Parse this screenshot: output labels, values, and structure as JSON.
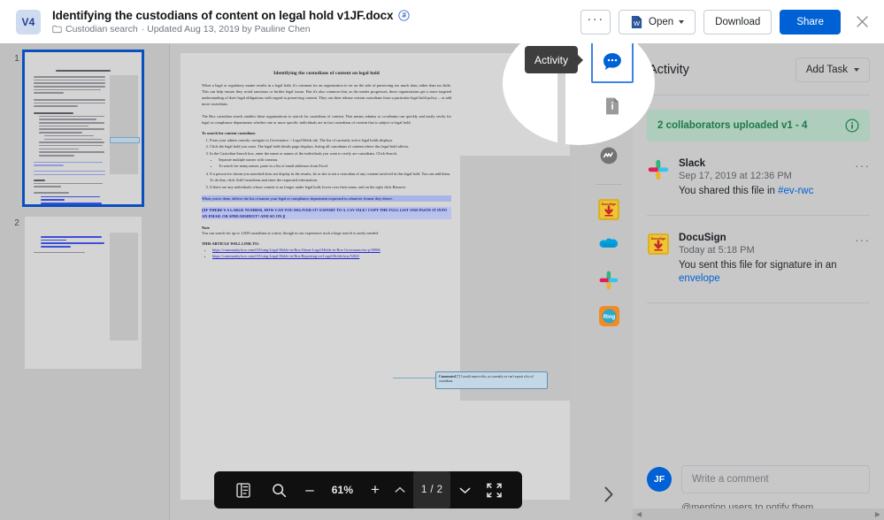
{
  "header": {
    "version_badge": "V4",
    "title": "Identifying the custodians of content on legal hold v1JF.docx",
    "folder_name": "Custodian search",
    "meta": "· Updated Aug 13, 2019 by Pauline Chen",
    "more_label": "···",
    "open_label": "Open",
    "download_label": "Download",
    "share_label": "Share",
    "accent_color": "#0061d5"
  },
  "thumbnails": {
    "pages": [
      {
        "number": "1",
        "selected": true
      },
      {
        "number": "2",
        "selected": false
      }
    ]
  },
  "document": {
    "heading": "Identifying the custodians of content on legal hold",
    "p1": "When a legal or regulatory matter results in a legal hold, it's common for an organization to err on the side of preserving too much data, rather than too little.  This can help ensure they avoid sanctions or further legal issues.  But it's also common that, as the matter progresses, these organizations get a more targeted understanding of their legal obligations with regard to preserving content.  They can then release certain custodians from a particular legal hold policy – or add more custodians.",
    "p2": "The Box custodian search enables these organizations to search for custodians of content.  That means admins or co-admins can quickly and easily verify for legal or compliance departments whether one or more specific individuals are in fact custodians of content that is subject to legal hold.",
    "section_heading": "To search for content custodians",
    "steps": [
      "From your admin console, navigate to Governance > Legal Holds tab.  The list of currently active legal holds displays.",
      "Click the legal hold you want.  The legal hold details page displays, listing all custodians of content where this legal hold affects.",
      "In the Custodian Search box, enter the name or names of the individuals you want to verify are custodians.  Click Search.",
      "If a person for whom you searched does not display in the results, he or she is not a custodian of any content involved in this legal hold. You can add them. To do that, click Add Custodians and enter the requested information.",
      "If there are any individuals whose content is no longer under legal hold, hover over their name, and on the right click Remove."
    ],
    "substeps": [
      "Separate multiple names with commas.",
      "To search for many names, paste in a list of email addresses from Excel."
    ],
    "highlight_para": "When you're done, deliver the list of names your legal or compliance department requested in whatever format they desire.",
    "caps_note": "[[IF THERE'S A LARGE NUMBER, HOW CAN YOU DELIVER IT?  EXPORT TO A .CSV FILE?  COPY THE FULL LIST AND PASTE IT INTO AN EMAIL OR SPREADSHEET?  AND SO ON.]]",
    "note_label": "Note",
    "note_body": "You can search for up to 1,000 custodians at a time, though in our experience such a large search is rarely needed.",
    "links_label": "THIS ARTICLE WILL LINK TO:",
    "links": [
      "https://community.box.com/t5/Using-Legal-Holds-in-Box/About-Legal-Holds-in-Box-Governance/ta-p/10886",
      "https://community.box.com/t5/Using-Legal-Holds-in-Box/Reporting-on-Legal-Holds/ta-p/52841"
    ],
    "comment_balloon": {
      "author": "Commented",
      "ref": "[7]",
      "text": "I would remove this, as currently we can't export a list of custodians."
    }
  },
  "doc_toolbar": {
    "thumbnails_icon": "thumbnails-icon",
    "search_icon": "search-icon",
    "zoom_out_label": "–",
    "zoom_level": "61%",
    "zoom_in_label": "+",
    "page_indicator": "1 / 2",
    "fullscreen_icon": "fullscreen-icon"
  },
  "rail": {
    "tabs": [
      {
        "name": "activity",
        "icon": "chat-bubble-icon",
        "active": true
      },
      {
        "name": "details",
        "icon": "file-info-icon",
        "active": false
      },
      {
        "name": "box-relay",
        "icon": "relay-circle-icon",
        "active": false
      }
    ],
    "apps": [
      {
        "name": "docusign",
        "icon": "docusign-icon"
      },
      {
        "name": "salesforce",
        "icon": "salesforce-cloud-icon"
      },
      {
        "name": "slack",
        "icon": "slack-icon"
      },
      {
        "name": "ringcentral",
        "icon": "ringcentral-icon"
      }
    ],
    "collapse_icon": "chevron-right-icon"
  },
  "sidepanel": {
    "title": "Activity",
    "add_task_label": "Add Task",
    "upload_banner": {
      "text": "2 collaborators uploaded v1 - 4",
      "info_icon": "info-circle-icon",
      "bg_color": "#aecdbc",
      "text_color": "#1d7a4b"
    },
    "items": [
      {
        "app": "Slack",
        "avatar": "slack-icon",
        "time": "Sep 17, 2019 at 12:36 PM",
        "message_prefix": "You shared this file in ",
        "message_link": "#ev-rwc",
        "more_label": "···"
      },
      {
        "app": "DocuSign",
        "avatar": "docusign-icon",
        "time": "Today at 5:18 PM",
        "message_prefix": "You sent this file for signature in an ",
        "message_link": "envelope",
        "more_label": "···"
      }
    ],
    "composer": {
      "avatar_initials": "JF",
      "placeholder": "Write a comment",
      "hint": "@mention users to notify them."
    }
  },
  "spotlight": {
    "tooltip_label": "Activity"
  }
}
